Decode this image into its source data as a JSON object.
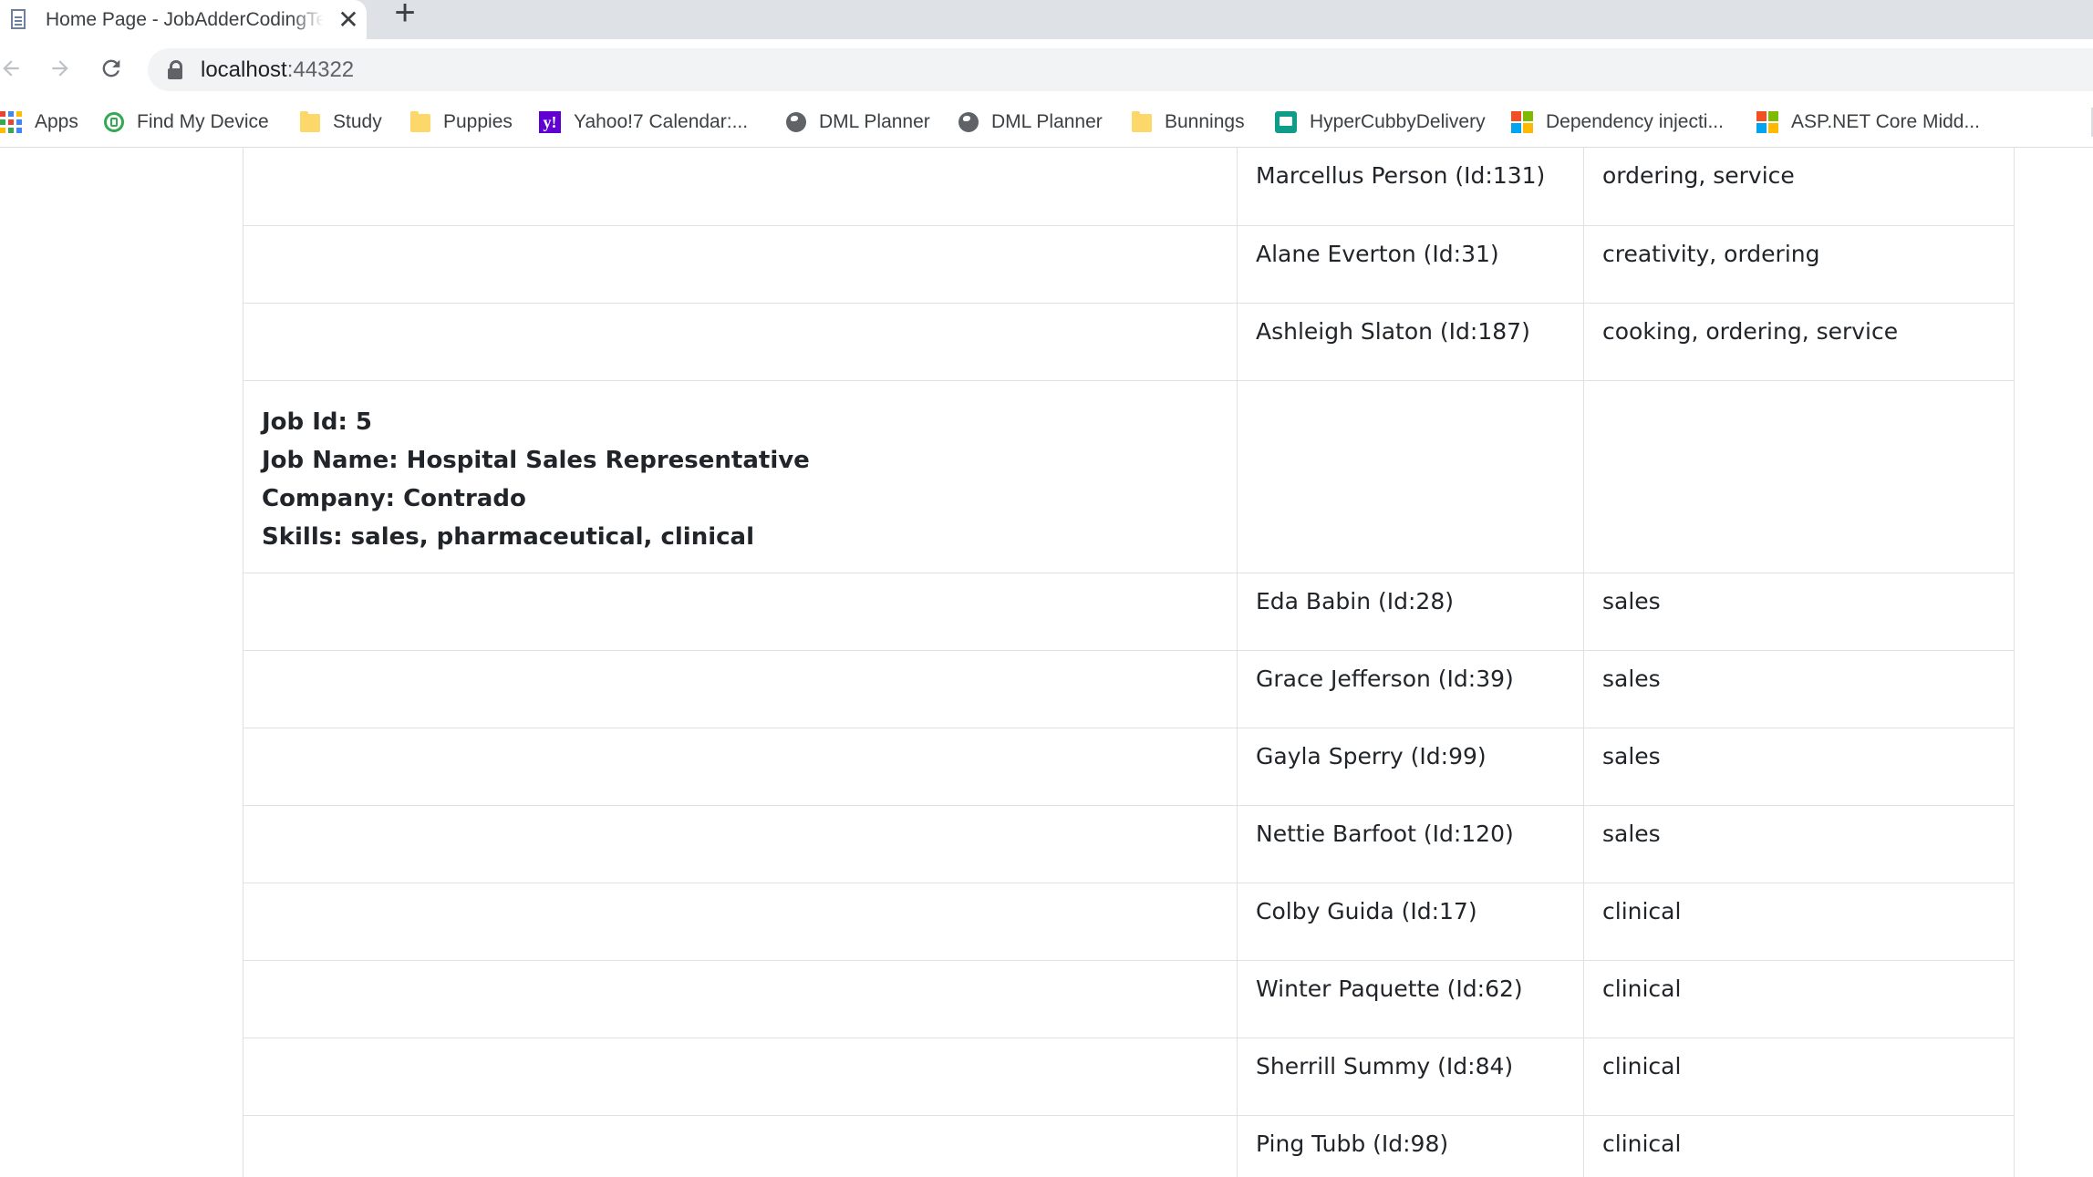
{
  "browser": {
    "tab": {
      "title": "Home Page - JobAdderCodingTest",
      "close_glyph": "✕"
    },
    "new_tab_glyph": "+",
    "address": {
      "host": "localhost",
      "port": ":44322"
    },
    "bookmarks": [
      {
        "label": "Apps",
        "icon": "apps-grid-icon"
      },
      {
        "label": "Find My Device",
        "icon": "find-my-device-icon"
      },
      {
        "label": "Study",
        "icon": "folder-icon"
      },
      {
        "label": "Puppies",
        "icon": "folder-icon"
      },
      {
        "label": "Yahoo!7 Calendar:...",
        "icon": "yahoo-icon"
      },
      {
        "label": "DML Planner",
        "icon": "globe-icon"
      },
      {
        "label": "DML Planner",
        "icon": "globe-icon"
      },
      {
        "label": "Bunnings",
        "icon": "folder-icon"
      },
      {
        "label": "HyperCubbyDelivery",
        "icon": "hypercubby-icon"
      },
      {
        "label": "Dependency injecti...",
        "icon": "microsoft-icon"
      },
      {
        "label": "ASP.NET Core Midd...",
        "icon": "microsoft-icon"
      }
    ]
  },
  "colors": {
    "tabstrip_bg": "#dee1e6",
    "omnibox_bg": "#f1f3f4",
    "table_border": "#dee2e6",
    "text": "#212529"
  },
  "rows_before": [
    {
      "candidate": "Marcellus Person (Id:131)",
      "skills": "ordering, service"
    },
    {
      "candidate": "Alane Everton (Id:31)",
      "skills": "creativity, ordering"
    },
    {
      "candidate": "Ashleigh Slaton (Id:187)",
      "skills": "cooking, ordering, service"
    }
  ],
  "job": {
    "id_line": "Job Id: 5",
    "name_line": "Job Name: Hospital Sales Representative",
    "company_line": "Company: Contrado",
    "skills_line": "Skills: sales, pharmaceutical, clinical"
  },
  "rows_after": [
    {
      "candidate": "Eda Babin (Id:28)",
      "skills": "sales"
    },
    {
      "candidate": "Grace Jefferson (Id:39)",
      "skills": "sales"
    },
    {
      "candidate": "Gayla Sperry (Id:99)",
      "skills": "sales"
    },
    {
      "candidate": "Nettie Barfoot (Id:120)",
      "skills": "sales"
    },
    {
      "candidate": "Colby Guida (Id:17)",
      "skills": "clinical"
    },
    {
      "candidate": "Winter Paquette (Id:62)",
      "skills": "clinical"
    },
    {
      "candidate": "Sherrill Summy (Id:84)",
      "skills": "clinical"
    },
    {
      "candidate": "Ping Tubb (Id:98)",
      "skills": "clinical"
    }
  ]
}
